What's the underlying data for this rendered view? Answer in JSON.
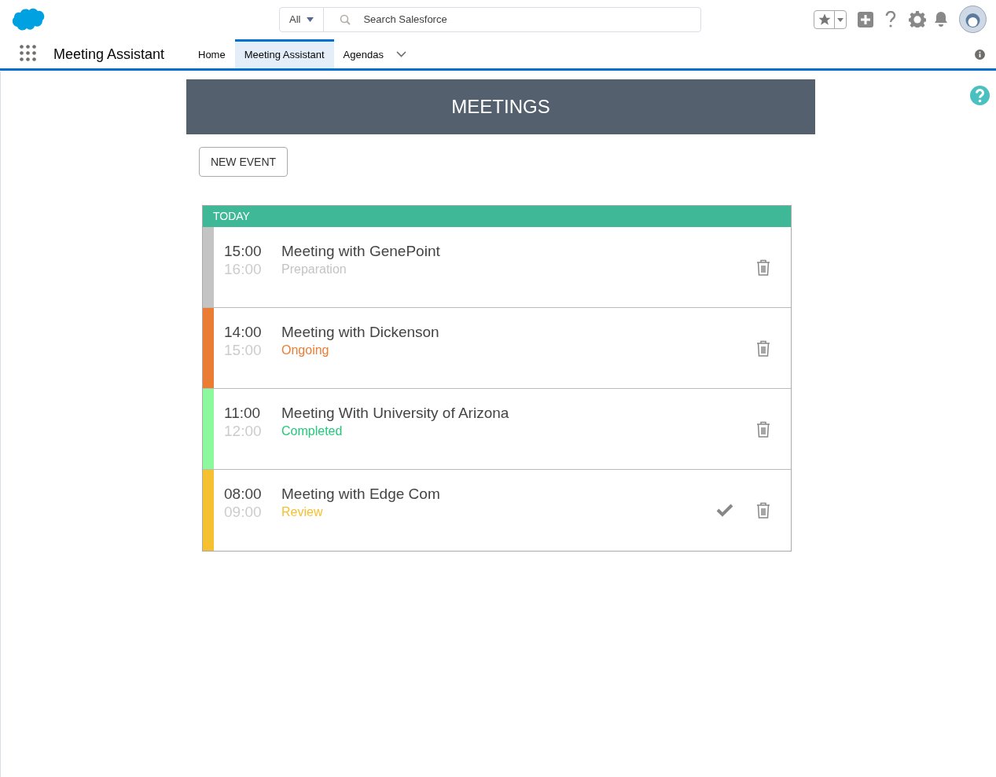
{
  "search": {
    "scope": "All",
    "placeholder": "Search Salesforce"
  },
  "app_name": "Meeting Assistant",
  "nav_tabs": [
    {
      "label": "Home",
      "selected": false,
      "has_menu": false
    },
    {
      "label": "Meeting Assistant",
      "selected": true,
      "has_menu": false
    },
    {
      "label": "Agendas",
      "selected": false,
      "has_menu": true
    }
  ],
  "page_title": "MEETINGS",
  "new_event_button": "NEW EVENT",
  "section": {
    "title": "TODAY"
  },
  "meetings": [
    {
      "start": "15:00",
      "end": "16:00",
      "title": "Meeting with GenePoint",
      "status": "Preparation",
      "kind": "preparation",
      "color": "#c4c4c4",
      "approvable": false
    },
    {
      "start": "14:00",
      "end": "15:00",
      "title": "Meeting with Dickenson",
      "status": "Ongoing",
      "kind": "ongoing",
      "color": "#ea7d33",
      "approvable": false
    },
    {
      "start": "11:00",
      "end": "12:00",
      "title": "Meeting With University of Arizona",
      "status": "Completed",
      "kind": "completed",
      "color": "#8cfa9c",
      "approvable": false
    },
    {
      "start": "08:00",
      "end": "09:00",
      "title": "Meeting with Edge Com",
      "status": "Review",
      "kind": "review",
      "color": "#f5c131",
      "approvable": true
    }
  ]
}
